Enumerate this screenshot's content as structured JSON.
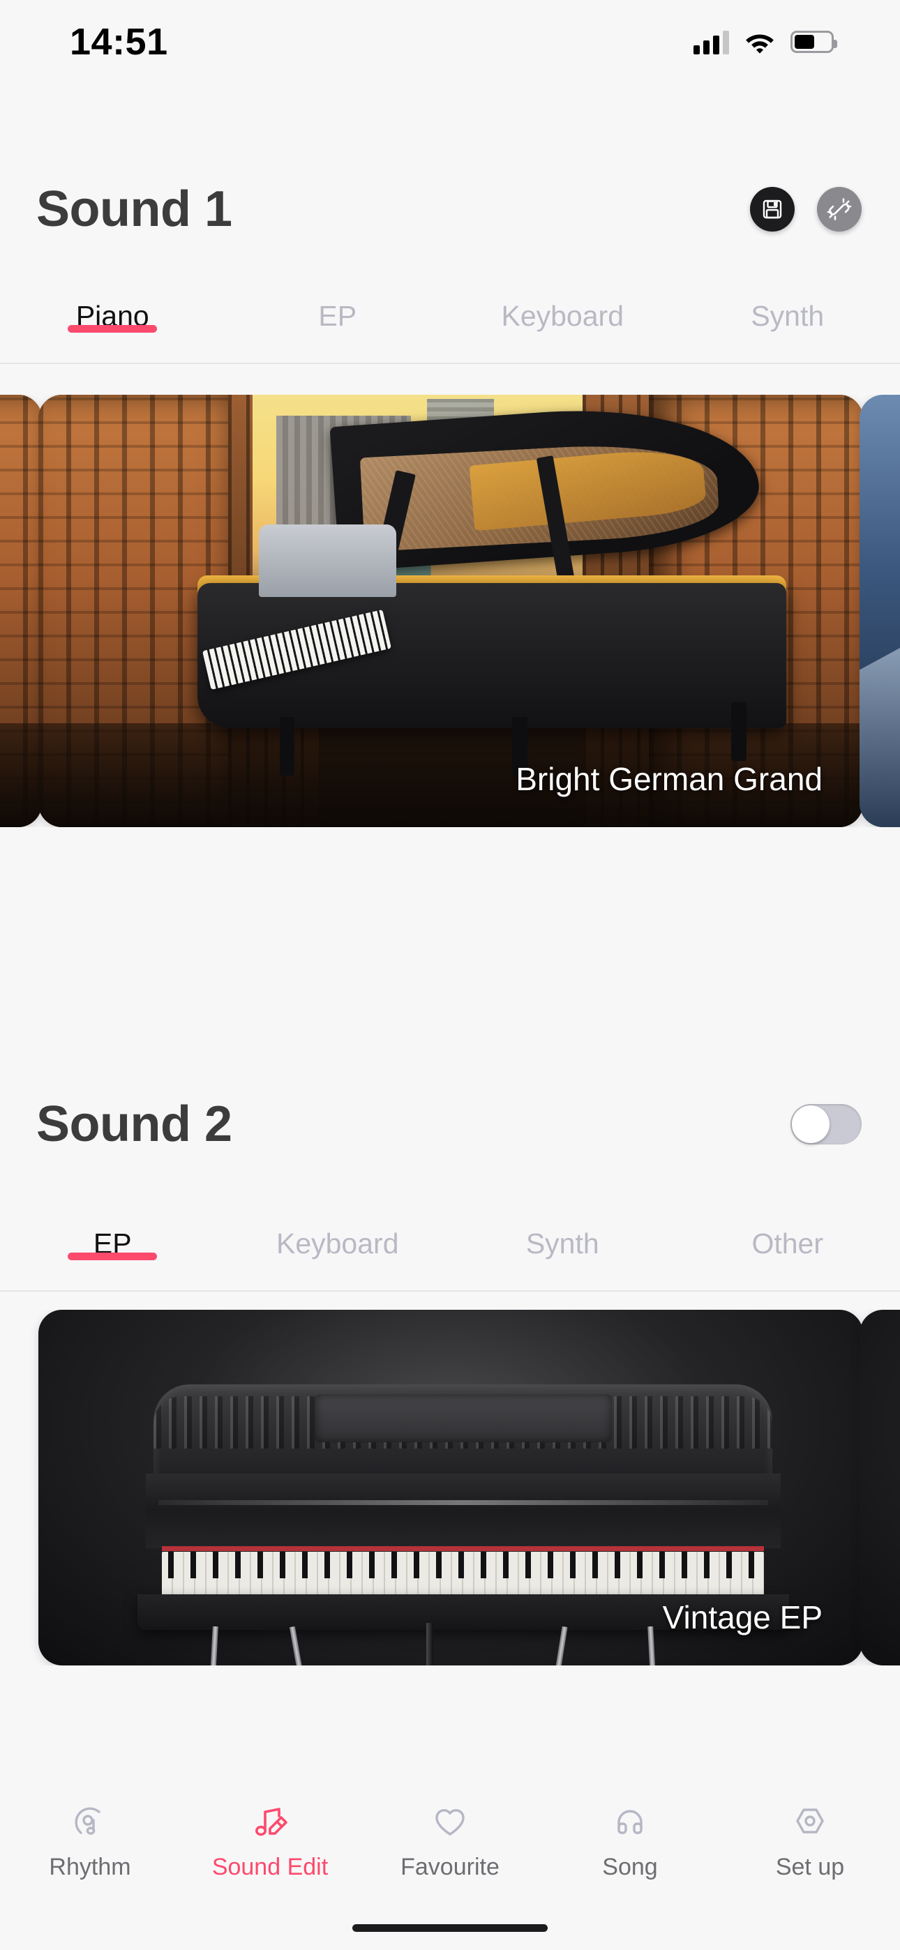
{
  "status_bar": {
    "time": "14:51",
    "signal_icon": "cellular-signal-icon",
    "wifi_icon": "wifi-icon",
    "battery_icon": "battery-icon"
  },
  "sound1": {
    "title": "Sound 1",
    "save_icon": "save-floppy-icon",
    "unlink_icon": "broken-link-icon",
    "tabs": [
      {
        "label": "Piano",
        "active": true
      },
      {
        "label": "EP",
        "active": false
      },
      {
        "label": "Keyboard",
        "active": false
      },
      {
        "label": "Synth",
        "active": false
      }
    ],
    "card": {
      "label": "Bright German Grand"
    }
  },
  "sound2": {
    "title": "Sound 2",
    "enabled": false,
    "toggle_name": "sound2-enable-toggle",
    "tabs": [
      {
        "label": "EP",
        "active": true
      },
      {
        "label": "Keyboard",
        "active": false
      },
      {
        "label": "Synth",
        "active": false
      },
      {
        "label": "Other",
        "active": false
      }
    ],
    "card": {
      "label": "Vintage EP"
    }
  },
  "bottom_nav": [
    {
      "label": "Rhythm",
      "icon": "rhythm-disc-note-icon",
      "active": false
    },
    {
      "label": "Sound Edit",
      "icon": "note-pencil-icon",
      "active": true
    },
    {
      "label": "Favourite",
      "icon": "heart-icon",
      "active": false
    },
    {
      "label": "Song",
      "icon": "headphones-icon",
      "active": false
    },
    {
      "label": "Set up",
      "icon": "hexagon-gear-icon",
      "active": false
    }
  ],
  "colors": {
    "accent": "#fc4a6d",
    "background": "#f7f7f8",
    "title": "#3c3c3c",
    "tab_inactive": "#b9b9c4",
    "nav_inactive": "#b6b7c4"
  }
}
